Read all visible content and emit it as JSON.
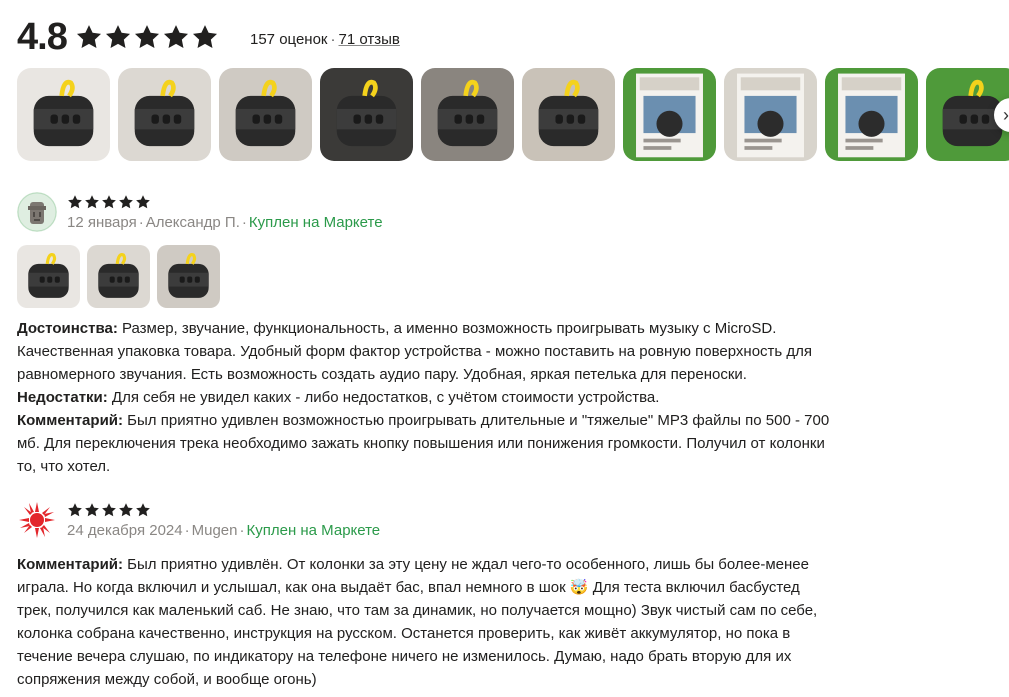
{
  "rating": {
    "value": "4.8",
    "stars": 5,
    "ratings_count": "157 оценок",
    "separator": "·",
    "reviews_link": "71 отзыв"
  },
  "colors": {
    "star": "#21201f",
    "verified": "#2b9a4a",
    "meta": "#8a8784",
    "accent_yellow": "#f4d21c"
  },
  "photo_strip": {
    "next_icon": "chevron-right-icon",
    "photos": [
      {
        "kind": "speaker-front",
        "bg": "#e9e6e2"
      },
      {
        "kind": "speaker-top",
        "bg": "#dcd8d2"
      },
      {
        "kind": "speaker-back",
        "bg": "#cfcac3"
      },
      {
        "kind": "speaker-hand",
        "bg": "#3b3a38"
      },
      {
        "kind": "speaker-side",
        "bg": "#8a857f"
      },
      {
        "kind": "speaker-hand-2",
        "bg": "#c9c2b8"
      },
      {
        "kind": "box-front",
        "bg": "#4f9a3a"
      },
      {
        "kind": "box-back",
        "bg": "#d8d4cc"
      },
      {
        "kind": "box-open",
        "bg": "#4f9a3a"
      },
      {
        "kind": "speaker-green",
        "bg": "#4f9a3a"
      }
    ]
  },
  "reviews": [
    {
      "avatar": "moai-avatar",
      "stars": 5,
      "date": "12 января",
      "author": "Александр П.",
      "badge": "Куплен на Маркете",
      "photos": [
        {
          "kind": "speaker-front"
        },
        {
          "kind": "speaker-top"
        },
        {
          "kind": "speaker-back"
        }
      ],
      "text": [
        {
          "label": "Достоинства:",
          "body": " Размер, звучание, функциональность, а именно возможность проигрывать музыку с MicroSD. Качественная упаковка товара. Удобный форм фактор устройства - можно поставить на ровную поверхность для равномерного звучания. Есть возможность создать аудио пару. Удобная, яркая петелька для переноски."
        },
        {
          "label": "Недостатки:",
          "body": " Для себя не увидел каких - либо недостатков, с учётом стоимости устройства."
        },
        {
          "label": "Комментарий:",
          "body": " Был приятно удивлен возможностью проигрывать длительные и \"тяжелые\" MP3 файлы по 500 - 700 мб. Для переключения трека необходимо зажать кнопку повышения или понижения громкости. Получил от колонки то, что хотел."
        }
      ]
    },
    {
      "avatar": "sun-avatar",
      "stars": 5,
      "date": "24 декабря 2024",
      "author": "Mugen",
      "badge": "Куплен на Маркете",
      "photos": [],
      "text": [
        {
          "label": "Комментарий:",
          "body": " Был приятно удивлён. От колонки за эту цену не ждал чего-то особенного, лишь бы более-менее играла. Но когда включил и услышал, как она выдаёт бас, впал немного в шок 🤯 Для теста включил басбустед трек, получился как маленький саб. Не знаю, что там за динамик, но получается мощно) Звук чистый сам по себе, колонка собрана качественно, инструкция на русском. Останется проверить, как живёт аккумулятор, но пока в течение вечера слушаю, по индикатору на телефоне ничего не изменилось. Думаю, надо брать вторую для их сопряжения между собой, и вообще огонь)"
        }
      ]
    }
  ]
}
